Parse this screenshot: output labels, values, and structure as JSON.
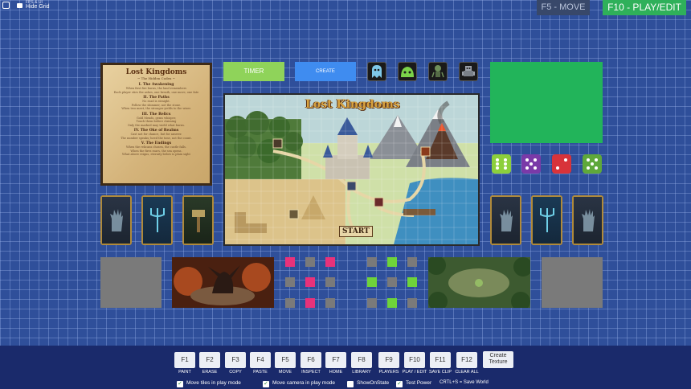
{
  "top_left": {
    "fps_text": "FPS & UI",
    "hide_grid_label": "Hide Grid",
    "grid_icon": "grid-icon",
    "lock_icon": "lock-icon"
  },
  "modes": {
    "move_label": "F5 - MOVE",
    "play_label": "F10 - PLAY/EDIT"
  },
  "rulebook": {
    "title": "Lost Kingdoms",
    "subtitle": "~ The Hidden Codex ~",
    "sections": [
      {
        "heading": "I. The Awakening",
        "lines": [
          "When first fire burns, the land remembers",
          "Each player stirs the ashes, one breath, one move, one fate"
        ]
      },
      {
        "heading": "II. The Paths",
        "lines": [
          "No road is straight.",
          "Follow the shimmer, not the stone.",
          "When two meet, the stronger yields to the wiser."
        ]
      },
      {
        "heading": "III. The Relics",
        "lines": [
          "Gold Mends, gems whisper,",
          "Touch them before claiming",
          "Only the marked may wield what burns."
        ]
      },
      {
        "heading": "IV. The Oke of Realms",
        "lines": [
          "Cast not for chance, but for answer.",
          "The number speaks; heed the tone, not the count."
        ]
      },
      {
        "heading": "V. The Endings",
        "lines": [
          "When the relicans chosen, the castle falls.",
          "When the fires roars, the sea opens.",
          "What above reigns, eternity below is plain sight"
        ]
      }
    ]
  },
  "controls": {
    "timer_label": "TIMER",
    "create_label": "CREATE"
  },
  "tokens": [
    {
      "icon": "ghost-token-icon",
      "color": "#7fc8e8"
    },
    {
      "icon": "slime-token-icon",
      "color": "#7bd34a"
    },
    {
      "icon": "goblin-token-icon",
      "color": "#6f8f5a"
    },
    {
      "icon": "robot-token-icon",
      "color": "#9aa0a8"
    }
  ],
  "dice": [
    {
      "color": "#8ccf3c",
      "value": 4
    },
    {
      "color": "#7a3aa8",
      "value": 4
    },
    {
      "color": "#d8333a",
      "value": 2
    },
    {
      "color": "#5fa83a",
      "value": 5
    }
  ],
  "map": {
    "title": "Lost Kingdoms",
    "start_label": "START",
    "colors": {
      "accent": "#d9a441"
    }
  },
  "cards_left": [
    {
      "icon": "ghost-hand-card-icon"
    },
    {
      "icon": "trident-card-icon"
    },
    {
      "icon": "hammer-card-icon"
    }
  ],
  "cards_right": [
    {
      "icon": "ghost-hand-card-icon"
    },
    {
      "icon": "trident-card-icon"
    },
    {
      "icon": "ghost-hand-card-icon"
    }
  ],
  "tiles": {
    "pink_color": "#e8327a",
    "green_color": "#6fd33a",
    "gray_color": "#7a7a7a"
  },
  "function_keys": [
    {
      "key": "F1",
      "label": "PAINT"
    },
    {
      "key": "F2",
      "label": "ERASE"
    },
    {
      "key": "F3",
      "label": "COPY"
    },
    {
      "key": "F4",
      "label": "PASTE"
    },
    {
      "key": "F5",
      "label": "MOVE"
    },
    {
      "key": "F6",
      "label": "INSPECT"
    },
    {
      "key": "F7",
      "label": "HOME"
    },
    {
      "key": "F8",
      "label": "LIBRARY"
    },
    {
      "key": "F9",
      "label": "PLAYERS"
    },
    {
      "key": "F10",
      "label": "PLAY / EDIT"
    },
    {
      "key": "F11",
      "label": "SAVE CLIP"
    },
    {
      "key": "F12",
      "label": "CLEAR ALL"
    }
  ],
  "create_texture_label": "Create Texture",
  "checkboxes": [
    {
      "label": "Move tiles in play mode",
      "checked": true
    },
    {
      "label": "Move camera in play mode",
      "checked": true
    },
    {
      "label": "ShowOnState",
      "checked": false
    },
    {
      "label": "Test Power",
      "checked": true
    }
  ],
  "save_hint": "CRTL+S = Save World"
}
